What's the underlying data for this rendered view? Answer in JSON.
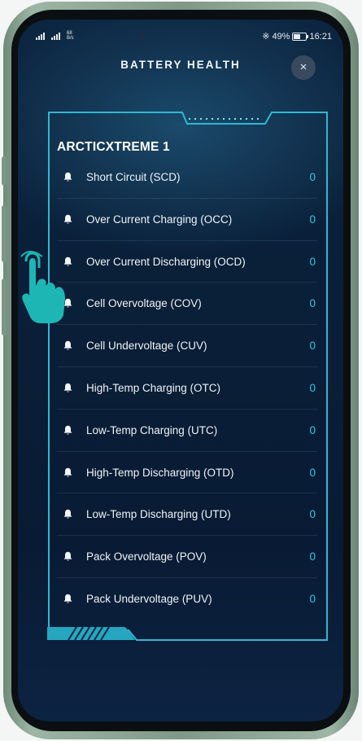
{
  "status_bar": {
    "network_speed_value": "68",
    "network_speed_unit": "B/s",
    "battery_percent": "49%",
    "time": "16:21"
  },
  "header": {
    "title": "BATTERY HEALTH",
    "close_label": "×"
  },
  "device": {
    "name": "ARCTICXTREME 1"
  },
  "alarms": [
    {
      "label": "Short Circuit (SCD)",
      "count": "0"
    },
    {
      "label": "Over Current Charging (OCC)",
      "count": "0"
    },
    {
      "label": "Over Current Discharging (OCD)",
      "count": "0"
    },
    {
      "label": "Cell Overvoltage (COV)",
      "count": "0"
    },
    {
      "label": "Cell Undervoltage (CUV)",
      "count": "0"
    },
    {
      "label": "High-Temp Charging (OTC)",
      "count": "0"
    },
    {
      "label": "Low-Temp Charging (UTC)",
      "count": "0"
    },
    {
      "label": "High-Temp Discharging (OTD)",
      "count": "0"
    },
    {
      "label": "Low-Temp Discharging (UTD)",
      "count": "0"
    },
    {
      "label": "Pack Overvoltage (POV)",
      "count": "0"
    },
    {
      "label": "Pack Undervoltage (PUV)",
      "count": "0"
    }
  ],
  "colors": {
    "accent": "#35c9e6",
    "frame": "#2fb8cf",
    "background": "#0a1f38"
  },
  "icons": {
    "alarm": "bell-icon",
    "close": "close-icon",
    "overlay": "tap-hand-icon"
  }
}
